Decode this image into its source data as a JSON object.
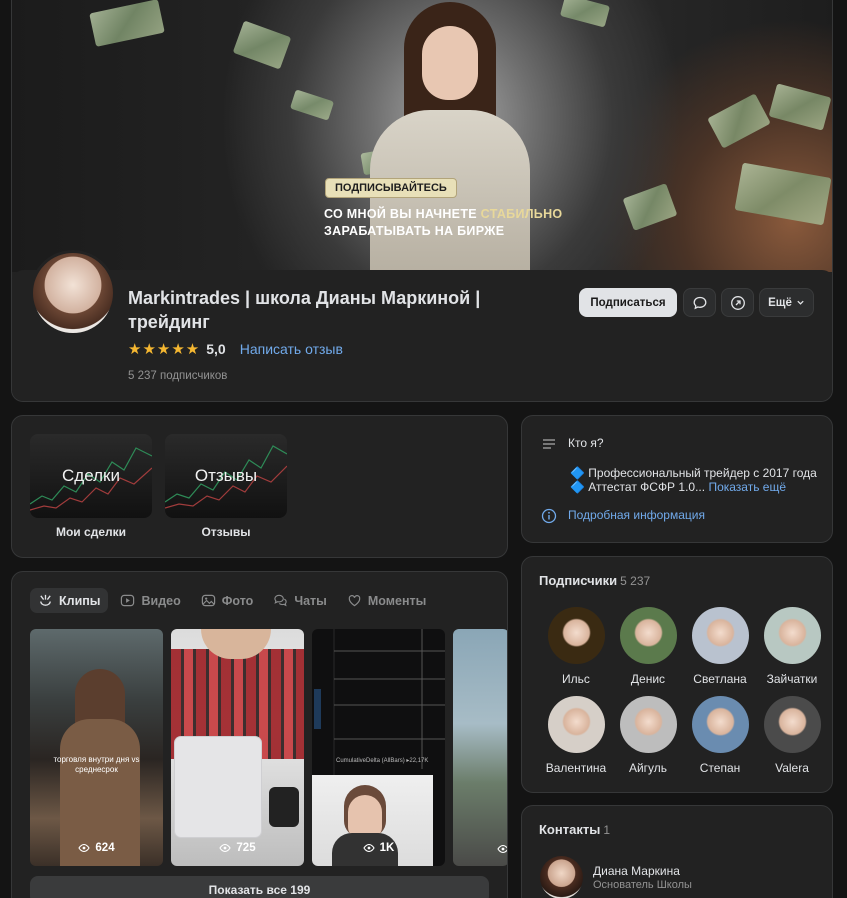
{
  "cover": {
    "badge": "ПОДПИСЫВАЙТЕСЬ",
    "line1_a": "СО МНОЙ ВЫ НАЧНЕТЕ ",
    "line1_b": "СТАБИЛЬНО",
    "line2": "ЗАРАБАТЫВАТЬ НА БИРЖЕ"
  },
  "profile": {
    "name": "Markintrades | школа Дианы Маркиной | трейдинг",
    "stars": "★★★★★",
    "rating": "5,0",
    "review_link": "Написать отзыв",
    "subscribers": "5 237 подписчиков"
  },
  "actions": {
    "subscribe": "Подписаться",
    "more": "Ещё"
  },
  "shortcuts": [
    {
      "tile": "Сделки",
      "caption": "Мои сделки"
    },
    {
      "tile": "Отзывы",
      "caption": "Отзывы"
    }
  ],
  "media": {
    "tabs": [
      "Клипы",
      "Видео",
      "Фото",
      "Чаты",
      "Моменты"
    ],
    "clips": [
      {
        "views": "624",
        "text": "торговля внутри дня vs среднесрок"
      },
      {
        "views": "725"
      },
      {
        "views": "1K",
        "overlay_text": "CumulativeDelta (AllBars) ▸22,17K"
      },
      {
        "views": ""
      }
    ],
    "show_all": "Показать все 199"
  },
  "about": {
    "title": "Кто я?",
    "line1": "🔷 Профессиональный трейдер с 2017 года",
    "line2": "🔷 Аттестат ФСФР 1.0...",
    "line2_more": "Показать ещё",
    "info_link": "Подробная информация"
  },
  "followers": {
    "title": "Подписчики",
    "count": "5 237",
    "items": [
      {
        "name": "Ильс",
        "color": "#3a2a12"
      },
      {
        "name": "Денис",
        "color": "#5b7a4c"
      },
      {
        "name": "Светлана",
        "color": "#b9c2cf"
      },
      {
        "name": "Зайчатки",
        "color": "#b8c8c2"
      },
      {
        "name": "Валентина",
        "color": "#d6cfc8"
      },
      {
        "name": "Айгуль",
        "color": "#bdbdbd"
      },
      {
        "name": "Степан",
        "color": "#6a8cb0"
      },
      {
        "name": "Valera",
        "color": "#4b4b4b"
      }
    ]
  },
  "contacts": {
    "title": "Контакты",
    "count": "1",
    "name": "Диана Маркина",
    "role": "Основатель Школы"
  },
  "colors": {
    "bg": "#141414",
    "card": "#222222",
    "accent_link": "#71aaeb",
    "star": "#f5b731"
  }
}
